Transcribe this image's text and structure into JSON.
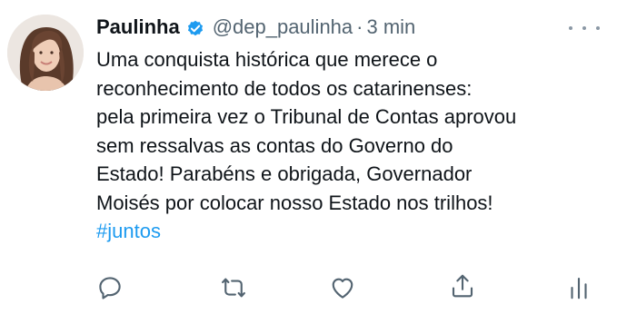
{
  "author": {
    "name": "Paulinha",
    "handle": "@dep_paulinha",
    "separator": "·",
    "time": "3 min"
  },
  "tweet": {
    "lines": [
      "Uma conquista histórica que merece o",
      "reconhecimento de todos os catarinenses:",
      "pela primeira vez o Tribunal de Contas aprovou",
      "sem ressalvas as contas do Governo do",
      "Estado! Parabéns e obrigada, Governador",
      "Moisés por colocar nosso Estado nos trilhos!"
    ],
    "hashtag": "#juntos"
  },
  "icons": {
    "verified": "verified-badge-icon",
    "more": "more-options-icon",
    "reply": "reply-icon",
    "retweet": "retweet-icon",
    "like": "heart-icon",
    "share": "share-icon",
    "analytics": "analytics-icon"
  },
  "colors": {
    "verified": "#1d9bf0",
    "hashtag": "#1d9bf0",
    "text": "#0f1419",
    "secondary": "#536471",
    "icon": "#536471"
  }
}
